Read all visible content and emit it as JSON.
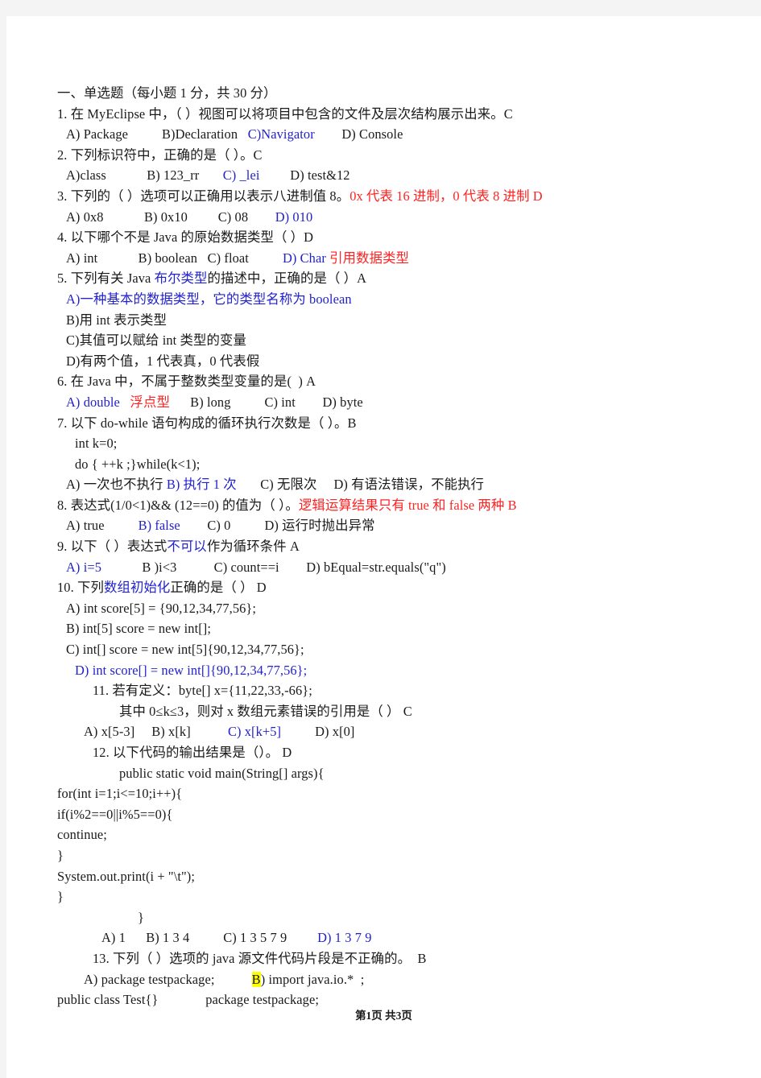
{
  "document": {
    "section_heading": "一、单选题（每小题 1 分，共 30 分）",
    "footer": "第1页 共3页",
    "colors": {
      "answer_blue": "#2222cc",
      "note_red": "#ff2222",
      "highlight_yellow": "#ffff00",
      "body_text": "#1a1a1a",
      "page_background": "#ffffff",
      "canvas_background": "#f4f4f4"
    }
  },
  "questions": {
    "q1": {
      "stem_a": "1. 在 MyEclipse 中，（ ）视图可以将项目中包含的文件及层次结构展示出来。C",
      "optA": "A) Package",
      "optB": "B)Declaration",
      "optC": "C)Navigator",
      "optD": "D) Console"
    },
    "q2": {
      "stem": "2. 下列标识符中，正确的是（ ）。C",
      "optA": "A)class",
      "optB": "B) 123_rr",
      "optC": "C) _lei",
      "optD": "D) test&12"
    },
    "q3": {
      "stem_black": "3. 下列的（ ）选项可以正确用以表示八进制值 8。",
      "stem_red": "0x 代表 16 进制，0 代表 8 进制 D",
      "optA": "A) 0x8",
      "optB": "B) 0x10",
      "optC": "C) 08",
      "optD": "D) 010"
    },
    "q4": {
      "stem": "4. 以下哪个不是 Java 的原始数据类型（ ）D",
      "optA": "A) int",
      "optB": "B) boolean",
      "optC": "C) float",
      "optD_blue": "D) Char ",
      "optD_red": "引用数据类型"
    },
    "q5": {
      "stem_1": "5. 下列有关 Java ",
      "stem_2_blue": "布尔类型",
      "stem_3": "的描述中，正确的是（ ）A",
      "optA": "A)一种基本的数据类型，它的类型名称为 boolean",
      "optB": "B)用 int 表示类型",
      "optC": "C)其值可以赋给 int 类型的变量",
      "optD": "D)有两个值，1 代表真，0 代表假"
    },
    "q6": {
      "stem": "6. 在 Java 中，不属于整数类型变量的是(  ) A",
      "optA_blue": "A) double",
      "optA_note_red": "浮点型",
      "optB": "B) long",
      "optC": "C) int",
      "optD": "D) byte"
    },
    "q7": {
      "stem": "7. 以下 do-while 语句构成的循环执行次数是（ ）。B",
      "code1": "int k=0;",
      "code2": "do { ++k ;}while(k<1);",
      "optA": "A) 一次也不执行 ",
      "optB_blue": "B) 执行 1 次",
      "optC": "C) 无限次",
      "optD": "D) 有语法错误，不能执行"
    },
    "q8": {
      "stem_black": "8. 表达式(1/0<1)&& (12==0) 的值为（ ）。",
      "stem_red": "逻辑运算结果只有 true 和 false 两种 B",
      "optA": "A) true",
      "optB": "B) false",
      "optC": "C) 0",
      "optD": "D) 运行时抛出异常"
    },
    "q9": {
      "stem_1": "9. 以下（ ）表达式",
      "stem_2_blue": "不可以",
      "stem_3": "作为循环条件 A",
      "optA": "A) i=5",
      "optB": "B )i<3",
      "optC": "C) count==i",
      "optD": "D) bEqual=str.equals(\"q\")"
    },
    "q10": {
      "stem_1": "10. 下列",
      "stem_2_blue": "数组初始化",
      "stem_3": "正确的是（ ） D",
      "optA": "A) int score[5] = {90,12,34,77,56};",
      "optB": "B) int[5] score = new int[];",
      "optC": "C) int[] score = new int[5]{90,12,34,77,56};",
      "optD": "D) int score[] = new int[]{90,12,34,77,56};"
    },
    "q11": {
      "stem_l1": "11. 若有定义：byte[] x={11,22,33,-66};",
      "stem_l2": "其中 0≤k≤3，则对 x 数组元素错误的引用是（ ） C",
      "optA": "A) x[5-3]",
      "optB": "B) x[k]",
      "optC": "C) x[k+5]",
      "optD": "D) x[0]"
    },
    "q12": {
      "stem": "12. 以下代码的输出结果是（）。 D",
      "code1": "public static void main(String[] args){",
      "code2": "for(int i=1;i<=10;i++){",
      "code3": "if(i%2==0||i%5==0){",
      "code4": "continue;",
      "code5": "}",
      "code6": "System.out.print(i + \"\\t\");",
      "code7": "}",
      "code8": "}",
      "optA": "A) 1",
      "optB": "B) 1 3 4",
      "optC": "C) 1 3 5 7 9",
      "optD": "D) 1 3 7 9"
    },
    "q13": {
      "stem": "13. 下列（ ）选项的 java 源文件代码片段是不正确的。  B",
      "optA": "A) package testpackage;",
      "optB_letter": "B",
      "optB_rest": ") import java.io.*  ;",
      "optA_line2": "public class Test{}",
      "optB_line2": "package testpackage;"
    }
  }
}
